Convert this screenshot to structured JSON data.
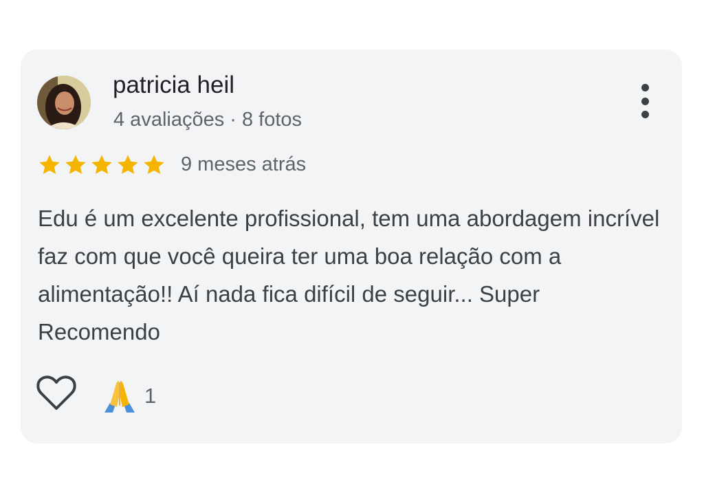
{
  "review": {
    "author": {
      "name": "patricia heil",
      "meta": "4 avaliações · 8 fotos"
    },
    "rating": {
      "stars": 5,
      "max": 5,
      "color": "#f4b400"
    },
    "date": "9 meses atrás",
    "text": "Edu é um excelente profissional, tem uma abordagem incrível faz com que você queira ter uma boa relação com a alimentação!! Aí nada fica difícil de seguir... Super Recomendo",
    "actions": {
      "like_icon": "heart-outline-icon",
      "more_icon": "more-vertical-icon",
      "reaction_icon": "folded-hands-emoji",
      "reaction_count": "1"
    }
  }
}
